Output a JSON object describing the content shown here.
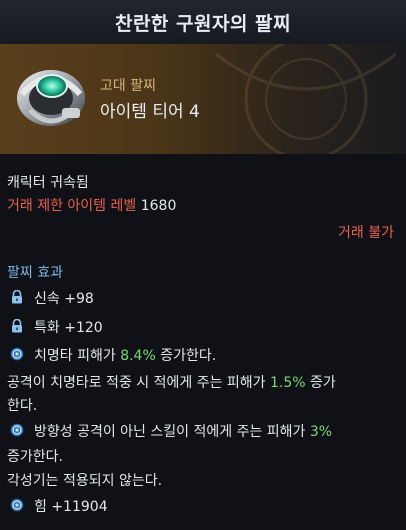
{
  "title": "찬란한 구원자의 팔찌",
  "item": {
    "grade": "고대 팔찌",
    "tier": "아이템 티어 4",
    "icon": "bracelet-icon"
  },
  "bound": "캐릭터 귀속됨",
  "trade_level_label": "거래 제한 아이템 레벨",
  "trade_level_value": "1680",
  "trade_status": "거래 불가",
  "effects_header": "팔찌 효과",
  "effects": {
    "swiftness": "신속 +98",
    "specialization": "특화 +120",
    "crit_pre": "치명타 피해가 ",
    "crit_val": "8.4%",
    "crit_post": " 증가한다.",
    "hit_line1_pre": "공격이 치명타로 적중 시 적에게 주는 피해가 ",
    "hit_line1_val": "1.5%",
    "hit_line1_post": " 증가",
    "hit_line2": "한다.",
    "nondir_pre": "방향성 공격이 아닌 스킬이 적에게 주는 피해가 ",
    "nondir_val": "3%",
    "nondir_line2": "증가한다.",
    "awakening": "각성기는 적용되지 않는다.",
    "strength": "힘 +11904"
  },
  "colors": {
    "red": "#e8614f",
    "green": "#79d873",
    "section": "#7fb4e8",
    "grade": "#d8b27a"
  }
}
